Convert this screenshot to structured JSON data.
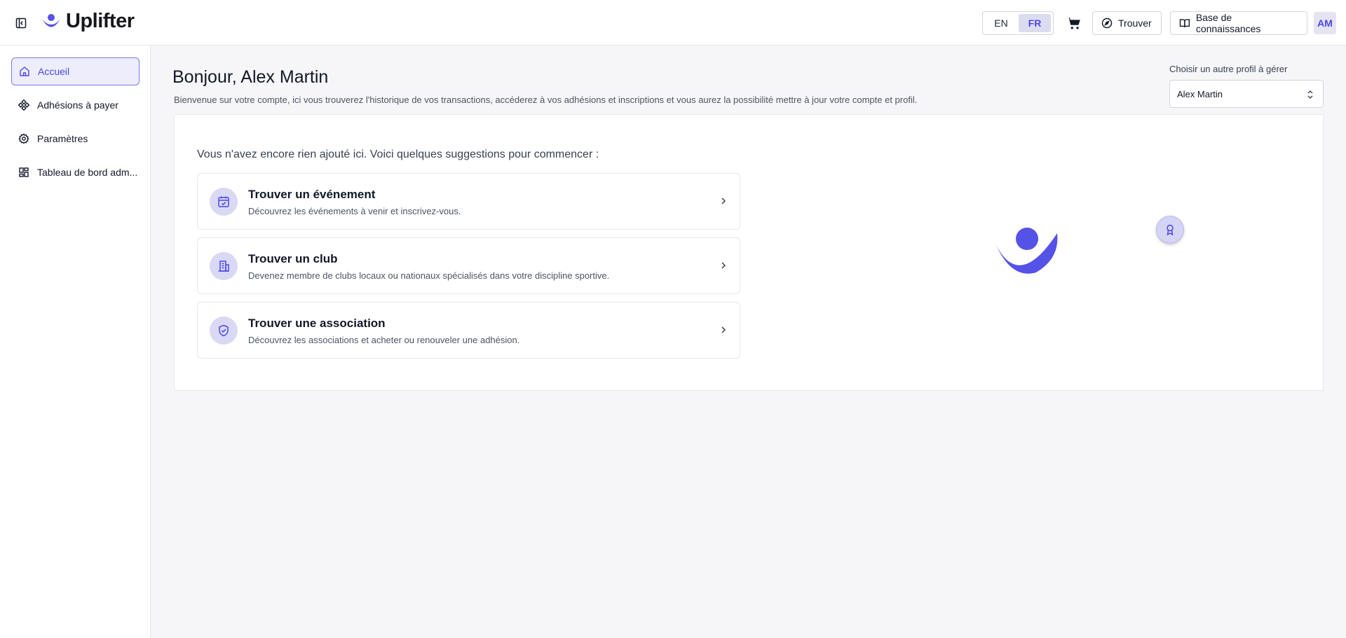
{
  "header": {
    "brand": "Uplifter",
    "languages": [
      {
        "code": "EN",
        "active": false
      },
      {
        "code": "FR",
        "active": true
      }
    ],
    "find_label": "Trouver",
    "knowledge_base_label": "Base de connaissances",
    "avatar_initials": "AM"
  },
  "sidebar": {
    "items": [
      {
        "label": "Accueil",
        "icon": "home-icon",
        "active": true
      },
      {
        "label": "Adhésions à payer",
        "icon": "components-icon",
        "active": false
      },
      {
        "label": "Paramètres",
        "icon": "gear-icon",
        "active": false
      },
      {
        "label": "Tableau de bord adm...",
        "icon": "dashboard-icon",
        "active": false
      }
    ]
  },
  "main": {
    "greeting": "Bonjour, Alex Martin",
    "welcome": "Bienvenue sur votre compte, ici vous trouverez l'historique de vos transactions, accéderez à vos adhésions et inscriptions et vous aurez la possibilité mettre à jour votre compte et profil.",
    "profile_label": "Choisir un autre profil à gérer",
    "profile_value": "Alex Martin",
    "intro": "Vous n'avez encore rien ajouté ici. Voici quelques suggestions pour commencer :",
    "suggestions": [
      {
        "title": "Trouver un événement",
        "description": "Découvrez les événements à venir et inscrivez-vous.",
        "icon": "calendar-check-icon"
      },
      {
        "title": "Trouver un club",
        "description": "Devenez membre de clubs locaux ou nationaux spécialisés dans votre discipline sportive.",
        "icon": "building-icon"
      },
      {
        "title": "Trouver une association",
        "description": "Découvrez les associations et acheter ou renouveler une adhésion.",
        "icon": "shield-check-icon"
      }
    ]
  },
  "colors": {
    "accent": "#4f46e5",
    "brand_logo": "#5552e8",
    "icon_bg": "#d9d9f5"
  }
}
